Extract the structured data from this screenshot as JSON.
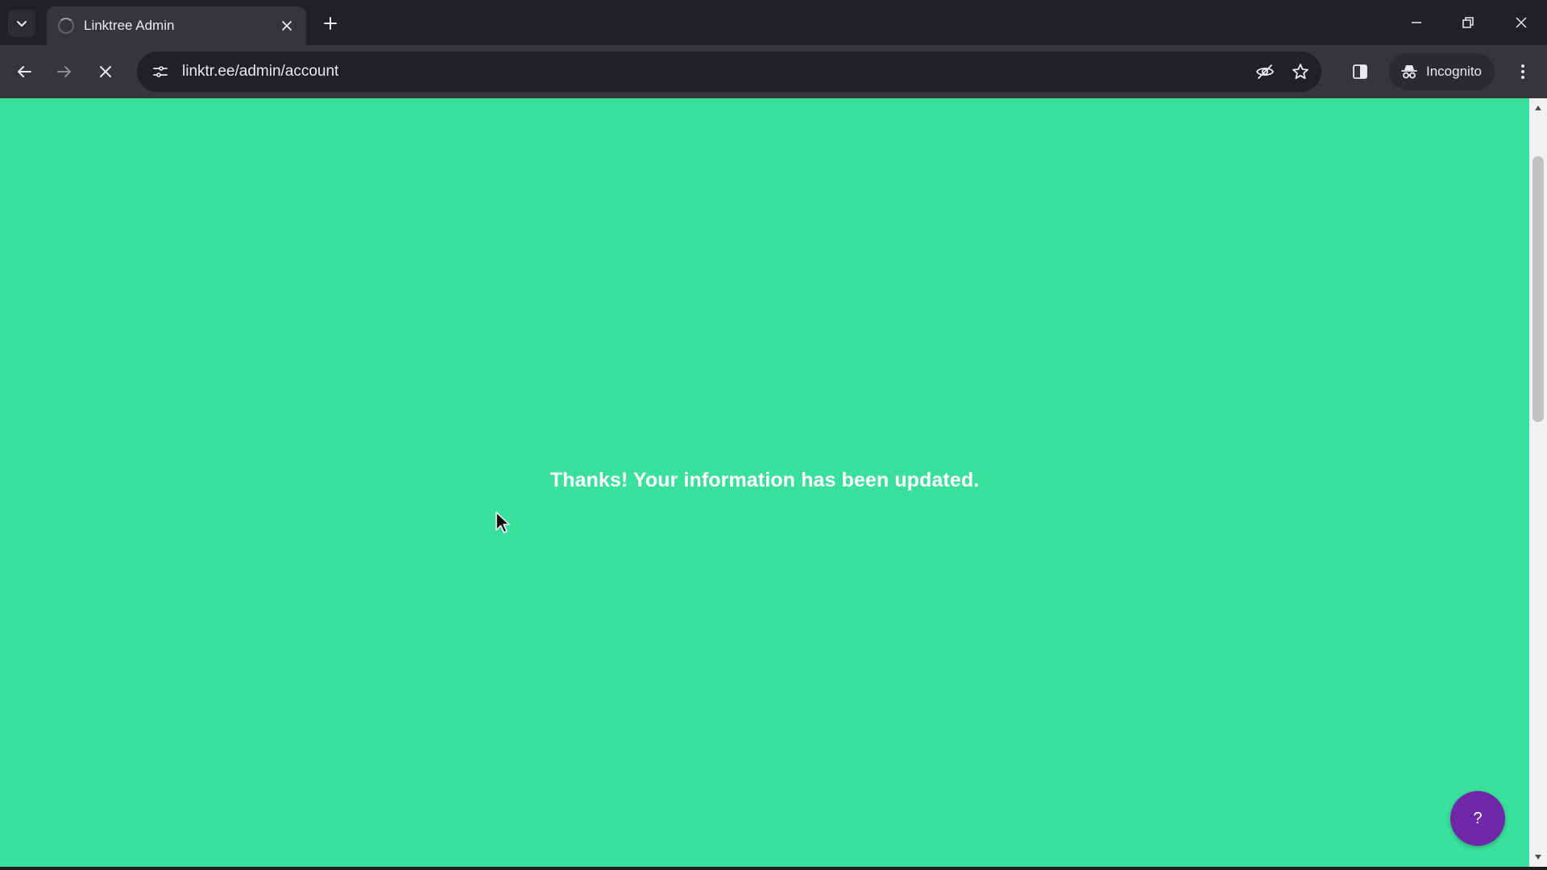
{
  "browser": {
    "tab": {
      "title": "Linktree Admin"
    },
    "address_bar": {
      "url": "linktr.ee/admin/account"
    },
    "incognito_label": "Incognito"
  },
  "page": {
    "message": "Thanks! Your information has been updated.",
    "help_button_label": "?",
    "background_color": "#39e09b",
    "help_button_color": "#6f28a8"
  }
}
